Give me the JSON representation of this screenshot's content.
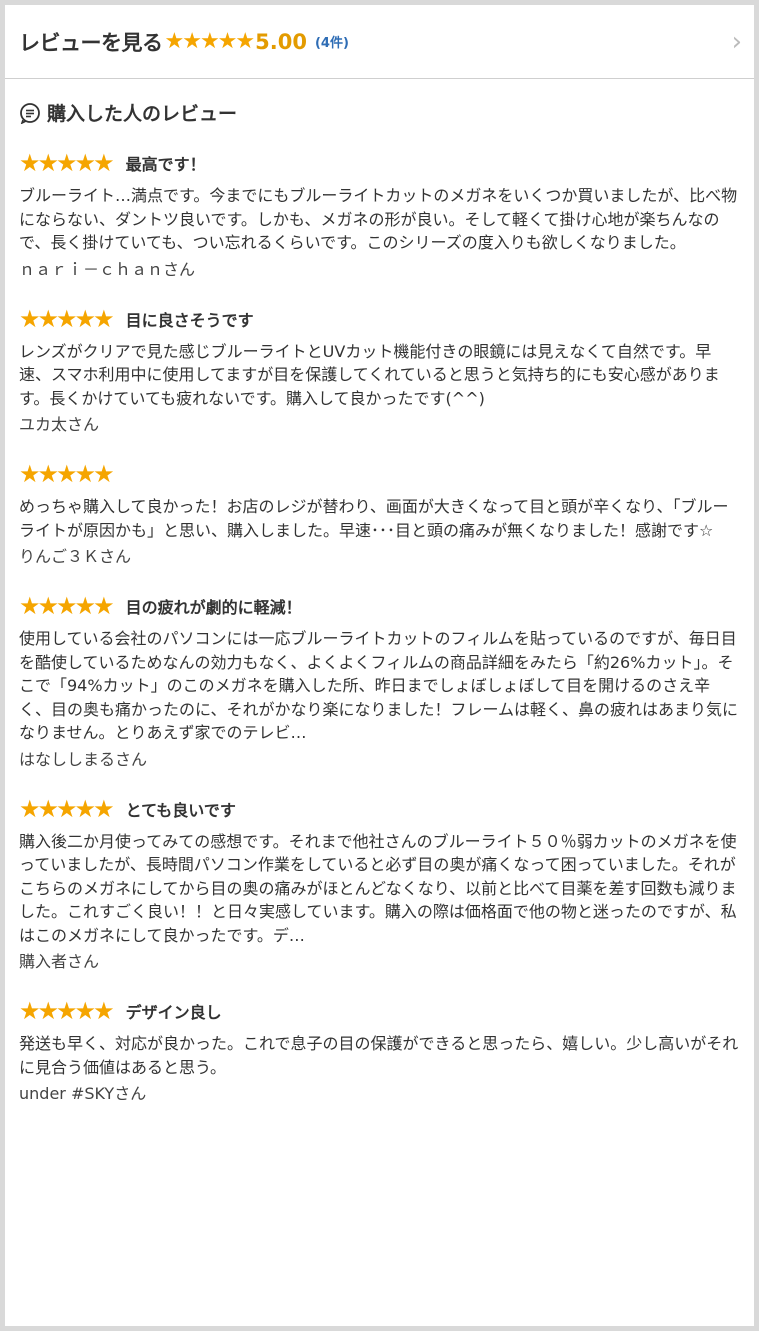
{
  "header": {
    "title": "レビューを見る",
    "stars": "★★★★★",
    "score": "5.00",
    "count": "(4件)"
  },
  "section": {
    "title": "購入した人のレビュー"
  },
  "reviews": [
    {
      "stars": "★★★★★",
      "title": "最高です！",
      "body": "ブルーライト…満点です。今までにもブルーライトカットのメガネをいくつか買いましたが、比べ物にならない、ダントツ良いです。しかも、メガネの形が良い。そして軽くて掛け心地が楽ちんなので、長く掛けていても、つい忘れるくらいです。このシリーズの度入りも欲しくなりました。",
      "reviewer": "ｎａｒｉ－ｃｈａｎさん"
    },
    {
      "stars": "★★★★★",
      "title": "目に良さそうです",
      "body": "レンズがクリアで見た感じブルーライトとUVカット機能付きの眼鏡には見えなくて自然です。早速、スマホ利用中に使用してますが目を保護してくれていると思うと気持ち的にも安心感があります。長くかけていても疲れないです。購入して良かったです(^^)",
      "reviewer": "ユカ太さん"
    },
    {
      "stars": "★★★★★",
      "title": "",
      "body": "めっちゃ購入して良かった！お店のレジが替わり、画面が大きくなって目と頭が辛くなり、「ブルーライトが原因かも」と思い、購入しました。早速･･･目と頭の痛みが無くなりました！感謝です☆",
      "reviewer": "りんご３Ｋさん"
    },
    {
      "stars": "★★★★★",
      "title": "目の疲れが劇的に軽減！",
      "body": "使用している会社のパソコンには一応ブルーライトカットのフィルムを貼っているのですが、毎日目を酷使しているためなんの効力もなく、よくよくフィルムの商品詳細をみたら「約26%カット」。そこで「94%カット」のこのメガネを購入した所、昨日までしょぼしょぼして目を開けるのさえ辛く、目の奥も痛かったのに、それがかなり楽になりました！フレームは軽く、鼻の疲れはあまり気になりません。とりあえず家でのテレビ…",
      "reviewer": "はなししまるさん"
    },
    {
      "stars": "★★★★★",
      "title": "とても良いです",
      "body": "購入後二か月使ってみての感想です。それまで他社さんのブルーライト５０％弱カットのメガネを使っていましたが、長時間パソコン作業をしていると必ず目の奥が痛くなって困っていました。それがこちらのメガネにしてから目の奥の痛みがほとんどなくなり、以前と比べて目薬を差す回数も減りました。これすごく良い！！と日々実感しています。購入の際は価格面で他の物と迷ったのですが、私はこのメガネにして良かったです。デ…",
      "reviewer": "購入者さん"
    },
    {
      "stars": "★★★★★",
      "title": "デザイン良し",
      "body": "発送も早く、対応が良かった。これで息子の目の保護ができると思ったら、嬉しい。少し高いがそれに見合う価値はあると思う。",
      "reviewer": "under #SKYさん"
    }
  ]
}
